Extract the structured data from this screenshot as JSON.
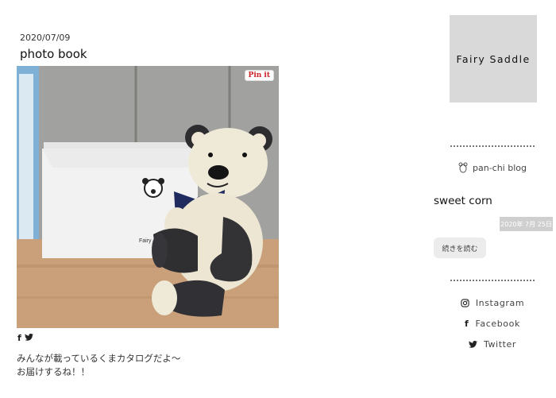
{
  "post": {
    "date": "2020/07/09",
    "title": "photo book",
    "pin_label": "Pin it",
    "share_icons": [
      "facebook-icon",
      "twitter-icon"
    ],
    "body_lines": [
      "みんなが載っているくまカタログだよ〜",
      "お届けするね！！"
    ]
  },
  "sidebar": {
    "logo_text": "Fairy Saddle",
    "blog_link": {
      "label": "pan-chi blog",
      "icon": "bear-icon"
    },
    "recent_post": {
      "title": "sweet corn",
      "date": "2020年 7月 25日",
      "read_more": "続きを読む"
    },
    "social_links": [
      {
        "label": "Instagram",
        "icon": "instagram-icon"
      },
      {
        "label": "Facebook",
        "icon": "facebook-icon"
      },
      {
        "label": "Twitter",
        "icon": "twitter-icon"
      }
    ]
  },
  "photo": {
    "envelope_text": "Fairy"
  },
  "colors": {
    "logo_bg": "#d9d9d9",
    "badge_bg": "#cfcfcf",
    "button_bg": "#ececec",
    "pinterest_red": "#cb2027"
  }
}
